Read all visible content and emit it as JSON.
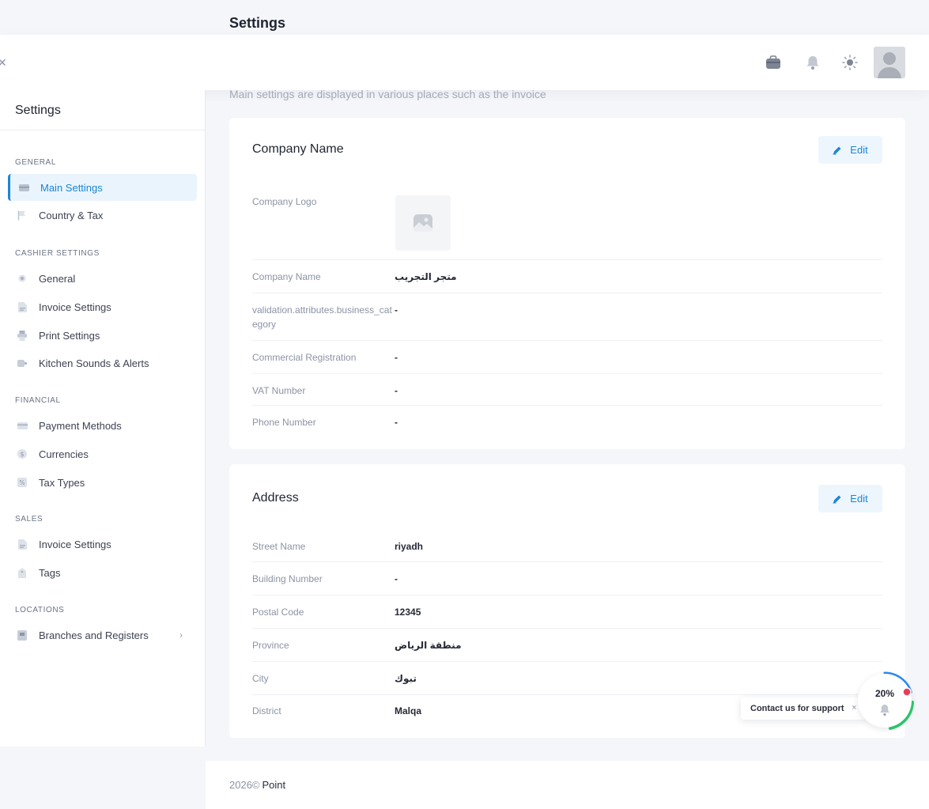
{
  "header": {
    "page_title": "Settings"
  },
  "topbar": {
    "close_glyph": "✕",
    "icons": [
      "briefcase-icon",
      "bell-icon",
      "sun-icon",
      "user-avatar"
    ]
  },
  "sidebar": {
    "title": "Settings",
    "sections": {
      "general": "GENERAL",
      "cashier": "CASHIER SETTINGS",
      "financial": "FINANCIAL",
      "sales": "SALES",
      "locations": "LOCATIONS"
    },
    "items": {
      "main_settings": "Main Settings",
      "country_tax": "Country & Tax",
      "general": "General",
      "invoice_settings": "Invoice Settings",
      "print_settings": "Print Settings",
      "kitchen_sounds": "Kitchen Sounds & Alerts",
      "payment_methods": "Payment Methods",
      "currencies": "Currencies",
      "tax_types": "Tax Types",
      "sales_invoice_settings": "Invoice Settings",
      "tags": "Tags",
      "branches_registers": "Branches and Registers"
    },
    "chevron": "›"
  },
  "main": {
    "subtitle": "Main settings are displayed in various places such as the invoice",
    "company_card": {
      "title": "Company Name",
      "edit_label": "Edit",
      "rows": {
        "logo_label": "Company Logo",
        "name_label": "Company Name",
        "name_value": "متجر التجريب",
        "category_label": "validation.attributes.business_category",
        "category_value": "-",
        "cr_label": "Commercial Registration",
        "cr_value": "-",
        "vat_label": "VAT Number",
        "vat_value": "-",
        "phone_label": "Phone Number",
        "phone_value": "-"
      }
    },
    "address_card": {
      "title": "Address",
      "edit_label": "Edit",
      "rows": {
        "street_label": "Street Name",
        "street_value": "riyadh",
        "building_label": "Building Number",
        "building_value": "-",
        "postal_label": "Postal Code",
        "postal_value": "12345",
        "province_label": "Province",
        "province_value": "منطقة الرياض",
        "city_label": "City",
        "city_value": "تبوك",
        "district_label": "District",
        "district_value": "Malqa"
      }
    }
  },
  "support": {
    "label": "Contact us for support",
    "close": "×",
    "progress_text": "20%",
    "progress_fraction": 0.2
  },
  "footer": {
    "copyright": "2026©",
    "brand": "Point"
  },
  "colors": {
    "accent": "#1b86d6",
    "active_bg": "#eaf4fd",
    "progress_blue": "#2d8cf0",
    "progress_green": "#2ecc71",
    "alert_red": "#e83e5a"
  }
}
